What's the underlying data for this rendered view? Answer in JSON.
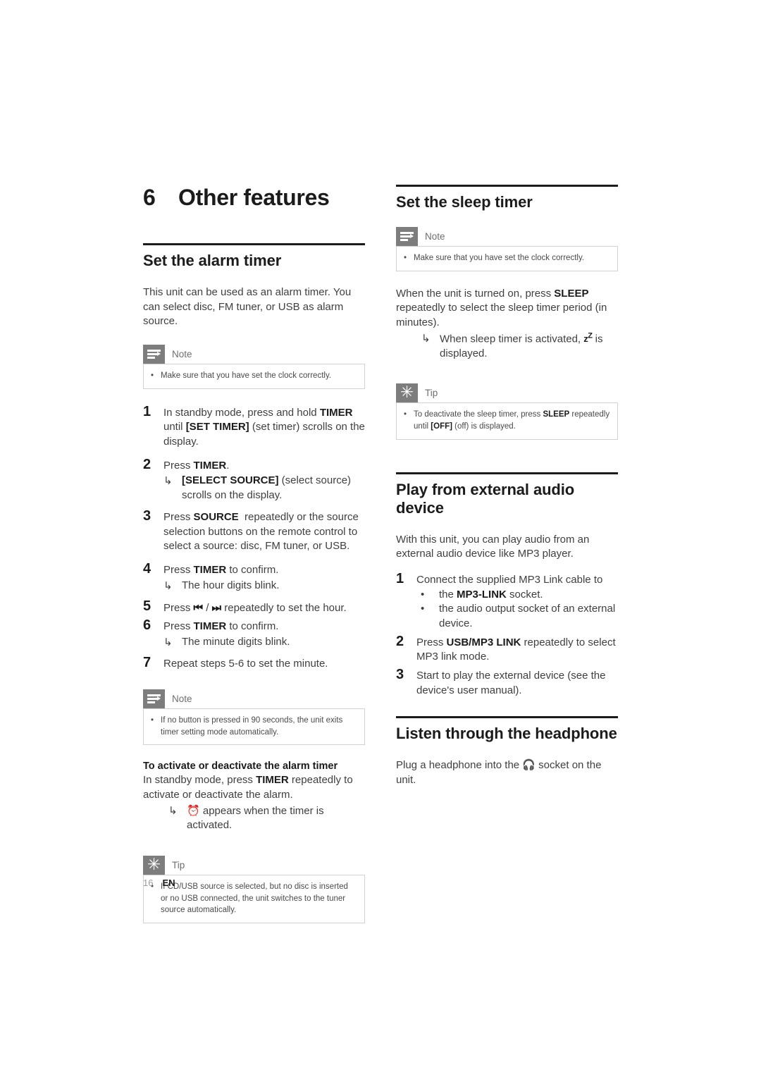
{
  "chapter": {
    "number": "6",
    "title": "Other features"
  },
  "left_column": {
    "alarm_section": {
      "heading": "Set the alarm timer",
      "intro": "This unit can be used as an alarm timer. You can select disc, FM tuner, or USB as alarm source.",
      "note": {
        "label": "Note",
        "icon": "note-icon",
        "items": [
          "Make sure that you have set the clock correctly."
        ]
      },
      "steps": [
        {
          "num": "1",
          "text_parts": [
            "In standby mode, press and hold ",
            "TIMER",
            " until ",
            "[SET TIMER]",
            " (set timer) scrolls on the display."
          ]
        },
        {
          "num": "2",
          "text_parts": [
            "Press ",
            "TIMER",
            "."
          ],
          "result": [
            "[SELECT SOURCE]",
            " (select source) scrolls on the display."
          ]
        },
        {
          "num": "3",
          "text_parts": [
            "Press ",
            "SOURCE",
            " repeatedly or the source selection buttons on the remote control to select a source: disc, FM tuner, or USB."
          ]
        },
        {
          "num": "4",
          "text_parts": [
            "Press ",
            "TIMER",
            " to confirm."
          ],
          "result": [
            "The hour digits blink."
          ]
        },
        {
          "num": "5",
          "text_parts": [
            "Press ",
            "⏮",
            " / ",
            "⏭",
            " repeatedly to set the hour."
          ]
        },
        {
          "num": "6",
          "text_parts": [
            "Press ",
            "TIMER",
            " to confirm."
          ],
          "result": [
            "The minute digits blink."
          ]
        },
        {
          "num": "7",
          "text_parts": [
            "Repeat steps 5-6 to set the minute."
          ]
        }
      ],
      "note2": {
        "label": "Note",
        "icon": "note-icon",
        "items": [
          "If no button is pressed in 90 seconds, the unit exits timer setting mode automatically."
        ]
      },
      "activate": {
        "heading": "To activate or deactivate the alarm timer",
        "body_parts": [
          "In standby mode, press ",
          "TIMER",
          " repeatedly to activate or deactivate the alarm."
        ],
        "result_icon": "alarm-bell-icon",
        "result_text": " appears when the timer is activated."
      },
      "tip": {
        "label": "Tip",
        "icon": "tip-starburst-icon",
        "items": [
          "If CD/USB source is selected, but no disc is inserted or no USB connected, the unit switches to the tuner source automatically."
        ]
      }
    }
  },
  "right_column": {
    "sleep_section": {
      "heading": "Set the sleep timer",
      "note": {
        "label": "Note",
        "icon": "note-icon",
        "items": [
          "Make sure that you have set the clock correctly."
        ]
      },
      "body_parts": [
        "When the unit is turned on, press ",
        "SLEEP",
        " repeatedly to select the sleep timer period (in minutes)."
      ],
      "result_prefix": "When sleep timer is activated, ",
      "result_symbol": "z",
      "result_symbol_sup": "Z",
      "result_suffix": " is displayed.",
      "tip": {
        "label": "Tip",
        "icon": "tip-starburst-icon",
        "items_parts": [
          [
            "To deactivate the sleep timer, press ",
            "SLEEP",
            " repeatedly until ",
            "[OFF]",
            " (off) is displayed."
          ]
        ]
      }
    },
    "external_section": {
      "heading_line1": "Play from external audio",
      "heading_line2": "device",
      "intro": "With this unit, you can play audio from an external audio device like MP3 player.",
      "steps": [
        {
          "num": "1",
          "text": "Connect the supplied MP3 Link cable to",
          "bullets_parts": [
            [
              "the ",
              "MP3-LINK",
              " socket."
            ],
            [
              "the audio output socket of an external device."
            ]
          ]
        },
        {
          "num": "2",
          "text_parts": [
            "Press ",
            "USB/MP3 LINK",
            " repeatedly to select MP3 link mode."
          ]
        },
        {
          "num": "3",
          "text_parts": [
            "Start to play the external device (see the device's user manual)."
          ]
        }
      ]
    },
    "headphone_section": {
      "heading": "Listen through the headphone",
      "body_prefix": "Plug a headphone into the ",
      "body_icon": "headphone-icon",
      "body_suffix": " socket on the unit."
    }
  },
  "footer": {
    "page_number": "16",
    "language": "EN"
  },
  "colors": {
    "callout_icon_bg": "#7d7d7d",
    "callout_border": "#d2d2d2",
    "heading": "#1b1b1b",
    "body": "#3f3f3f"
  }
}
